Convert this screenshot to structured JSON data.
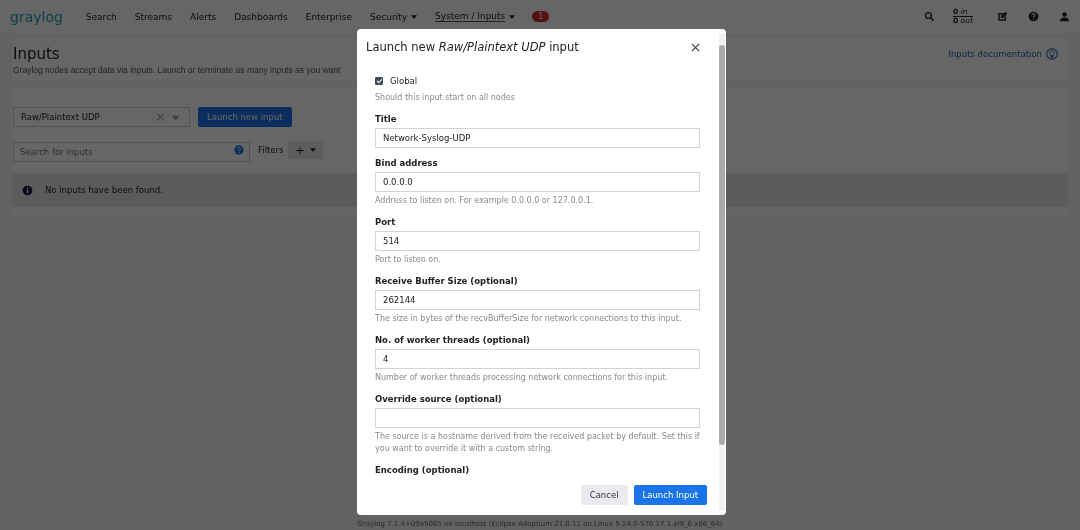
{
  "nav": {
    "logo": "graylog",
    "items": [
      {
        "label": "Search",
        "dropdown": false,
        "selected": false
      },
      {
        "label": "Streams",
        "dropdown": false,
        "selected": false
      },
      {
        "label": "Alerts",
        "dropdown": false,
        "selected": false
      },
      {
        "label": "Dashboards",
        "dropdown": false,
        "selected": false
      },
      {
        "label": "Enterprise",
        "dropdown": false,
        "selected": false
      },
      {
        "label": "Security",
        "dropdown": true,
        "selected": false
      },
      {
        "label": "System / Inputs",
        "dropdown": true,
        "selected": true
      }
    ],
    "badge": "1",
    "throughput": [
      "**0** *in*",
      "**0** *out*"
    ]
  },
  "page": {
    "title": "Inputs",
    "description": "Graylog nodes accept data via inputs. Launch or terminate as many inputs as you want",
    "doc_link": "Inputs documentation",
    "input_select": {
      "value": "Raw/Plaintext UDP"
    },
    "launch_button": "Launch new input",
    "search": {
      "placeholder": "Search for inputs"
    },
    "filters_label": "Filters",
    "add_filter": "+",
    "notice": "No inputs have been found.",
    "footer": "Graylog 7.1.4+09a5065 on localhost (Eclipse Adoptium 21.0.11 on Linux 5.14.0-570.17.1.el9_6.x86_64)"
  },
  "modal": {
    "title": "Launch new *Raw/Plaintext UDP* input",
    "fields": [
      {
        "kind": "checkbox",
        "label": "Global",
        "checked": true,
        "help": "Should this input start on all nodes"
      },
      {
        "kind": "text",
        "label": "Title",
        "value": "Network-Syslog-UDP"
      },
      {
        "kind": "text",
        "label": "Bind address",
        "value": "0.0.0.0",
        "help": "Address to listen on. For example 0.0.0.0 or 127.0.0.1."
      },
      {
        "kind": "text",
        "label": "Port",
        "value": "514",
        "help": "Port to listen on."
      },
      {
        "kind": "text",
        "label": "Receive Buffer Size (optional)",
        "value": "262144",
        "help": "The size in bytes of the recvBufferSize for network connections to this input."
      },
      {
        "kind": "text",
        "label": "No. of worker threads (optional)",
        "value": "4",
        "help": "Number of worker threads processing network connections for this input."
      },
      {
        "kind": "text",
        "label": "Override source (optional)",
        "help": "The source is a hostname derived from the received packet by default. Set this if you want to override it with a custom string."
      },
      {
        "kind": "label",
        "label": "Encoding (optional)"
      }
    ],
    "buttons": [
      {
        "label": "Cancel",
        "kind": "secondary"
      },
      {
        "label": "Launch Input",
        "kind": "primary"
      }
    ]
  }
}
